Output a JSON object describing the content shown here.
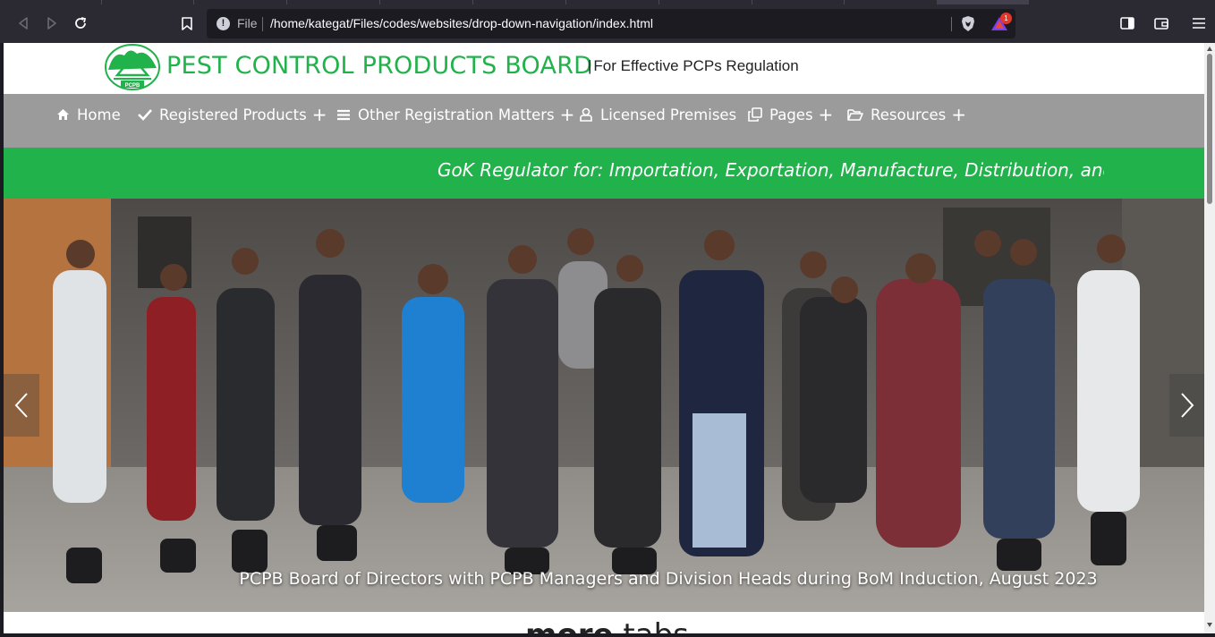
{
  "browser": {
    "url_scheme": "File",
    "url": "/home/kategat/Files/codes/websites/drop-down-navigation/index.html",
    "rewards_badge": "1"
  },
  "site": {
    "title": "PEST CONTROL PRODUCTS BOARD",
    "tagline_separator": "|",
    "tagline": "For Effective PCPs Regulation",
    "logo_text": "PCPB"
  },
  "nav": {
    "items": [
      {
        "label": "Home",
        "icon": "home-icon",
        "has_submenu": false
      },
      {
        "label": "Registered Products",
        "icon": "check-icon",
        "has_submenu": true
      },
      {
        "label": "Other Registration Matters",
        "icon": "list-icon",
        "has_submenu": true
      },
      {
        "label": "Licensed Premises",
        "icon": "user-icon",
        "has_submenu": false
      },
      {
        "label": "Pages",
        "icon": "clone-icon",
        "has_submenu": true
      },
      {
        "label": "Resources",
        "icon": "folder-open-icon",
        "has_submenu": true
      }
    ],
    "plus": "+"
  },
  "marquee": {
    "text": "GoK Regulator for: Importation, Exportation, Manufacture, Distribution, and s"
  },
  "carousel": {
    "caption": "PCPB Board of Directors with PCPB Managers and Division Heads during BoM Induction, August 2023"
  },
  "below": {
    "heading_bold": "more",
    "heading_rest": " tabs"
  },
  "colors": {
    "brand_green": "#22b24c",
    "nav_gray": "#9b9b9b"
  }
}
